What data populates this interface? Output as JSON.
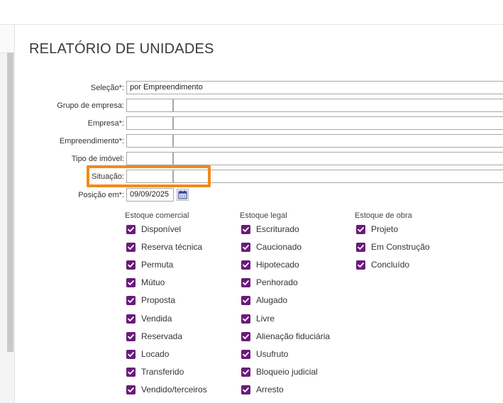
{
  "page": {
    "title": "RELATÓRIO DE UNIDADES"
  },
  "form": {
    "selecao": {
      "label": "Seleção*:",
      "value": "por Empreendimento"
    },
    "grupo_empresa": {
      "label": "Grupo de empresa:",
      "code": "",
      "name": ""
    },
    "empresa": {
      "label": "Empresa*:",
      "code": "",
      "name": ""
    },
    "empreendimento": {
      "label": "Empreendimento*:",
      "code": "",
      "name": ""
    },
    "tipo_imovel": {
      "label": "Tipo de imóvel:",
      "code": "",
      "name": ""
    },
    "situacao": {
      "label": "Situação:",
      "code": "",
      "name": ""
    },
    "posicao": {
      "label": "Posição em*:",
      "value": "09/09/2025"
    }
  },
  "groups": {
    "comercial": {
      "title": "Estoque comercial",
      "items": [
        "Disponível",
        "Reserva técnica",
        "Permuta",
        "Mútuo",
        "Proposta",
        "Vendida",
        "Reservada",
        "Locado",
        "Transferido",
        "Vendido/terceiros"
      ]
    },
    "legal": {
      "title": "Estoque legal",
      "items": [
        "Escriturado",
        "Caucionado",
        "Hipotecado",
        "Penhorado",
        "Alugado",
        "Livre",
        "Alienação fiduciária",
        "Usufruto",
        "Bloqueio judicial",
        "Arresto"
      ]
    },
    "obra": {
      "title": "Estoque de obra",
      "items": [
        "Projeto",
        "Em Construção",
        "Concluído"
      ]
    }
  },
  "colors": {
    "checkbox": "#6a1b7a",
    "highlight": "#f08a1c"
  },
  "icons": {
    "calendar": "calendar-icon",
    "check": "check-icon"
  }
}
